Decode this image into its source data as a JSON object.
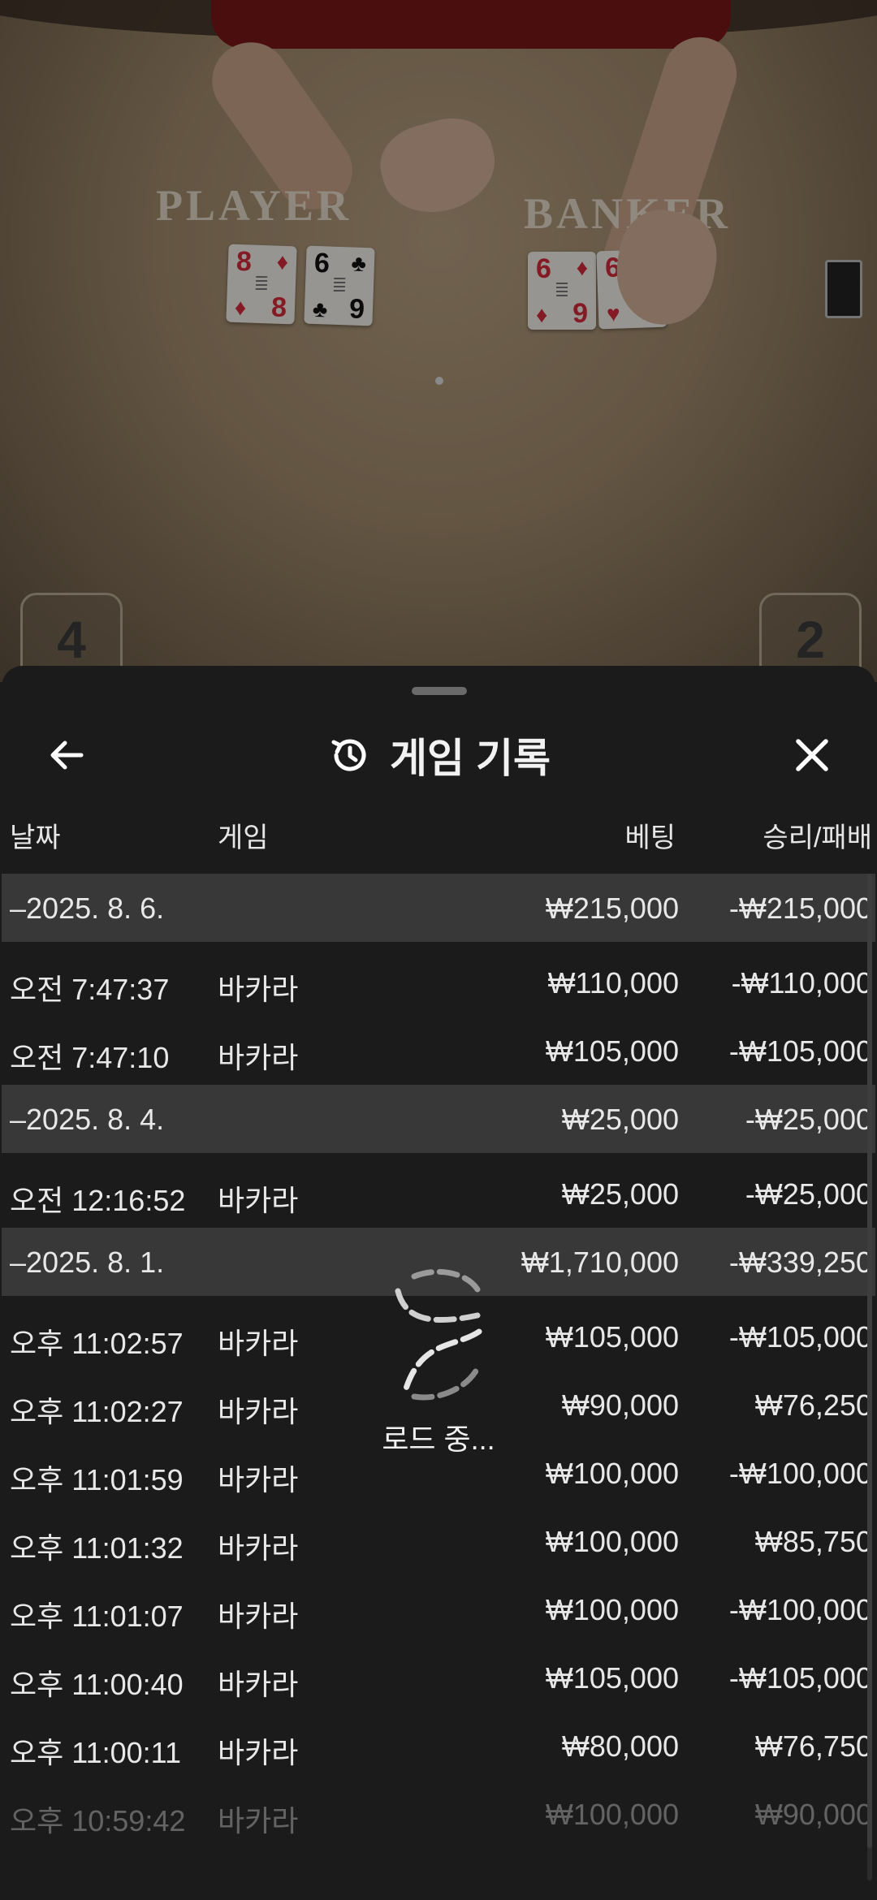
{
  "table": {
    "player_label": "PLAYER",
    "banker_label": "BANKER",
    "player_cards": [
      {
        "rank": "8",
        "suit": "♦",
        "color": "red"
      },
      {
        "rank": "6",
        "suit": "♣",
        "color": "black",
        "rank_bottom": "9"
      }
    ],
    "banker_cards": [
      {
        "rank": "6",
        "suit": "♦",
        "color": "red",
        "rank_bottom": "9"
      },
      {
        "rank": "6",
        "suit": "♥",
        "color": "red",
        "rank_bottom": "9"
      }
    ],
    "player_count": "4",
    "banker_count": "2"
  },
  "header": {
    "title": "게임 기록",
    "back_icon": "arrow-left-icon",
    "history_icon": "history-icon",
    "close_icon": "close-icon"
  },
  "columns": {
    "date": "날짜",
    "game": "게임",
    "bet": "베팅",
    "result": "승리/패배"
  },
  "groups": [
    {
      "date": "–2025. 8. 6.",
      "bet": "₩215,000",
      "result": "-₩215,000",
      "rows": [
        {
          "time": "오전 7:47:37",
          "game": "바카라",
          "bet": "₩110,000",
          "result": "-₩110,000"
        },
        {
          "time": "오전 7:47:10",
          "game": "바카라",
          "bet": "₩105,000",
          "result": "-₩105,000"
        }
      ]
    },
    {
      "date": "–2025. 8. 4.",
      "bet": "₩25,000",
      "result": "-₩25,000",
      "rows": [
        {
          "time": "오전 12:16:52",
          "game": "바카라",
          "bet": "₩25,000",
          "result": "-₩25,000"
        }
      ]
    },
    {
      "date": "–2025. 8. 1.",
      "bet": "₩1,710,000",
      "result": "-₩339,250",
      "rows": [
        {
          "time": "오후 11:02:57",
          "game": "바카라",
          "bet": "₩105,000",
          "result": "-₩105,000"
        },
        {
          "time": "오후 11:02:27",
          "game": "바카라",
          "bet": "₩90,000",
          "result": "₩76,250"
        },
        {
          "time": "오후 11:01:59",
          "game": "바카라",
          "bet": "₩100,000",
          "result": "-₩100,000"
        },
        {
          "time": "오후 11:01:32",
          "game": "바카라",
          "bet": "₩100,000",
          "result": "₩85,750"
        },
        {
          "time": "오후 11:01:07",
          "game": "바카라",
          "bet": "₩100,000",
          "result": "-₩100,000"
        },
        {
          "time": "오후 11:00:40",
          "game": "바카라",
          "bet": "₩105,000",
          "result": "-₩105,000"
        },
        {
          "time": "오후 11:00:11",
          "game": "바카라",
          "bet": "₩80,000",
          "result": "₩76,750"
        },
        {
          "time": "오후 10:59:42",
          "game": "바카라",
          "bet": "₩100,000",
          "result": "₩90,000"
        }
      ]
    }
  ],
  "loading": {
    "text": "로드 중...",
    "icon": "loading-spinner-icon"
  }
}
